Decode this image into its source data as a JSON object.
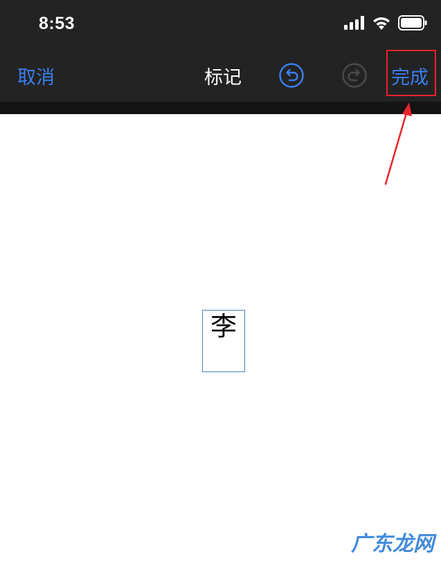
{
  "status_bar": {
    "time": "8:53",
    "signal_icon": "cellular-signal-icon",
    "wifi_icon": "wifi-icon",
    "battery_icon": "battery-icon"
  },
  "nav_bar": {
    "cancel_label": "取消",
    "title": "标记",
    "undo_icon": "undo-icon",
    "redo_icon": "redo-icon",
    "done_label": "完成"
  },
  "annotation": {
    "highlight_color": "#e8232a",
    "arrow_color": "#e8232a"
  },
  "canvas": {
    "text_content": "李"
  },
  "watermark": {
    "text": "广东龙网"
  },
  "colors": {
    "accent": "#3a7ff0",
    "bar_background": "#232323",
    "canvas_background": "#ffffff"
  }
}
